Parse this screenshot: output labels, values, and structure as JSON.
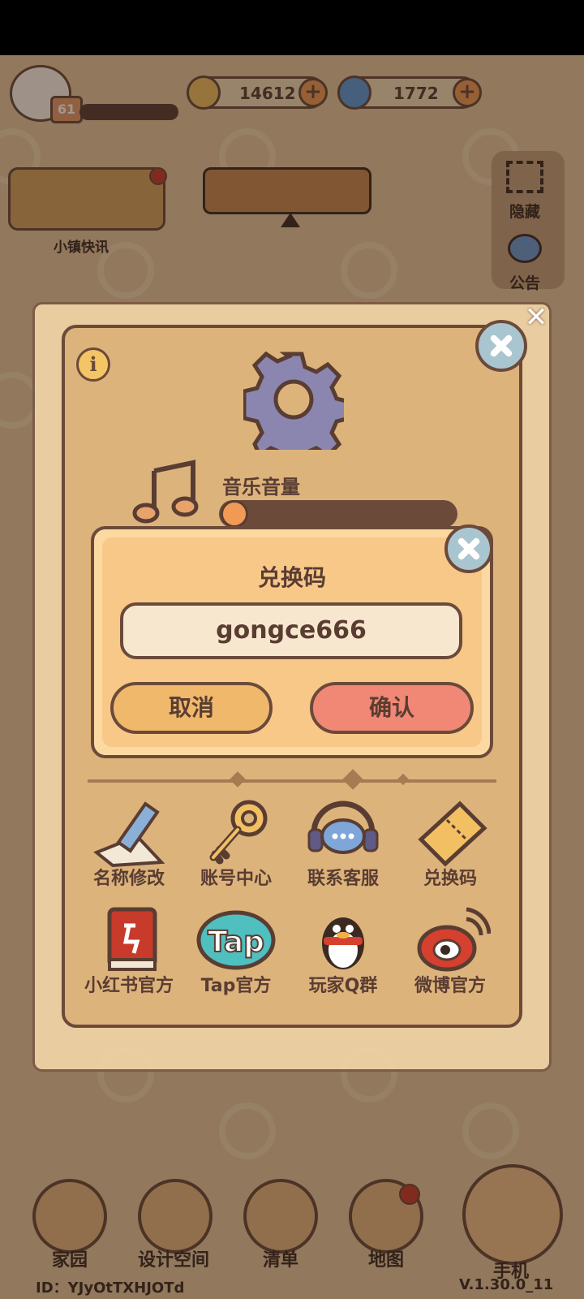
{
  "hud": {
    "level": "61",
    "gold": "14612",
    "gems": "1772"
  },
  "side": {
    "news_label": "小镇快讯",
    "hide_label": "隐藏",
    "notice_label": "公告"
  },
  "settings": {
    "music_volume_label": "音乐音量",
    "grid_row1": [
      "名称修改",
      "账号中心",
      "联系客服",
      "兑换码"
    ],
    "grid_row2": [
      "小红书官方",
      "Tap官方",
      "玩家Q群",
      "微博官方"
    ]
  },
  "dialog": {
    "title": "兑换码",
    "code_value": "gongce666",
    "cancel_label": "取消",
    "confirm_label": "确认"
  },
  "nav": {
    "home": "家园",
    "design": "设计空间",
    "list": "清单",
    "map": "地图",
    "phone": "手机"
  },
  "footer": {
    "id_text": "ID：YJyOtTXHJOTd",
    "version": "V.1.30.0_11"
  }
}
